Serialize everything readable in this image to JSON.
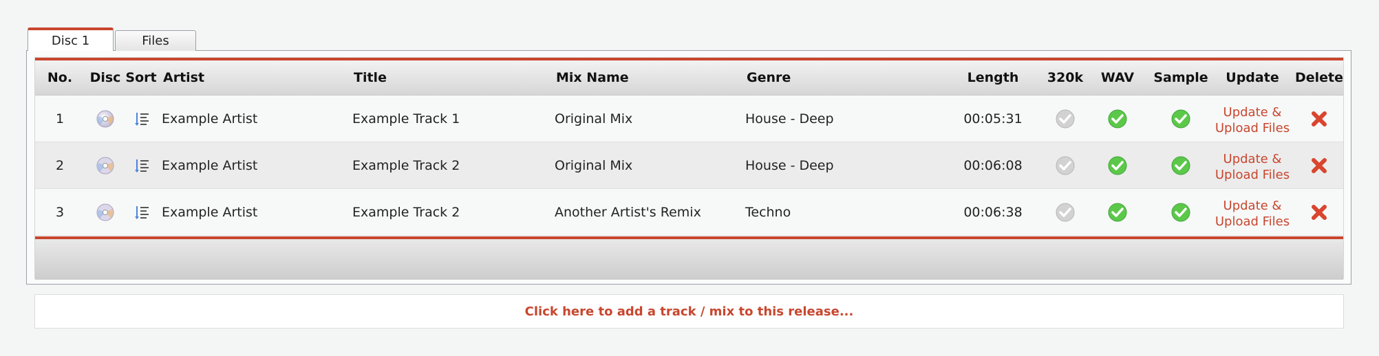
{
  "tabs": [
    {
      "label": "Disc 1",
      "active": true
    },
    {
      "label": "Files",
      "active": false
    }
  ],
  "columns": {
    "no": "No.",
    "disc": "Disc",
    "sort": "Sort",
    "artist": "Artist",
    "title": "Title",
    "mix_name": "Mix Name",
    "genre": "Genre",
    "length": "Length",
    "k320": "320k",
    "wav": "WAV",
    "sample": "Sample",
    "update": "Update",
    "delete": "Delete"
  },
  "tracks": [
    {
      "no": "1",
      "artist": "Example Artist",
      "title": "Example Track 1",
      "mix_name": "Original Mix",
      "genre": "House - Deep",
      "length": "00:05:31",
      "k320": false,
      "wav": true,
      "sample": true,
      "update_label": "Update & Upload Files"
    },
    {
      "no": "2",
      "artist": "Example Artist",
      "title": "Example Track 2",
      "mix_name": "Original Mix",
      "genre": "House - Deep",
      "length": "00:06:08",
      "k320": false,
      "wav": true,
      "sample": true,
      "update_label": "Update & Upload Files"
    },
    {
      "no": "3",
      "artist": "Example Artist",
      "title": "Example Track 2",
      "mix_name": "Another Artist's Remix",
      "genre": "Techno",
      "length": "00:06:38",
      "k320": false,
      "wav": true,
      "sample": true,
      "update_label": "Update & Upload Files"
    }
  ],
  "add_track_label": "Click here to add a track / mix to this release...",
  "icons": {
    "disc": "disc-icon",
    "sort": "sort-list-icon",
    "status_on": "check-green-icon",
    "status_off": "check-grey-icon",
    "delete": "delete-x-icon"
  },
  "colors": {
    "accent": "#c8462e",
    "check_on": "#5cc84a",
    "check_off": "#c9c9c9",
    "delete": "#d9452e"
  }
}
